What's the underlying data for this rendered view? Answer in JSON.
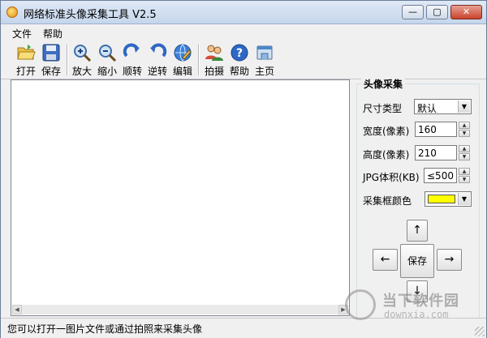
{
  "window": {
    "title": "网络标准头像采集工具 V2.5",
    "min_glyph": "—",
    "max_glyph": "▢",
    "close_glyph": "✕"
  },
  "menu": {
    "items": [
      {
        "label": "文件"
      },
      {
        "label": "帮助"
      }
    ]
  },
  "toolbar": {
    "items": [
      {
        "label": "打开",
        "icon": "open-folder-icon"
      },
      {
        "label": "保存",
        "icon": "save-disk-icon"
      },
      {
        "label": "放大",
        "icon": "zoom-in-icon"
      },
      {
        "label": "缩小",
        "icon": "zoom-out-icon"
      },
      {
        "label": "顺转",
        "icon": "rotate-cw-icon"
      },
      {
        "label": "逆转",
        "icon": "rotate-ccw-icon"
      },
      {
        "label": "编辑",
        "icon": "edit-icon"
      },
      {
        "label": "拍摄",
        "icon": "camera-people-icon"
      },
      {
        "label": "帮助",
        "icon": "help-icon"
      },
      {
        "label": "主页",
        "icon": "home-icon"
      }
    ]
  },
  "panel": {
    "title": "头像采集",
    "size_type_label": "尺寸类型",
    "size_type_value": "默认",
    "width_label": "宽度(像素)",
    "width_value": "160",
    "height_label": "高度(像素)",
    "height_value": "210",
    "jpg_label": "JPG体积(KB)",
    "jpg_value": "≤500",
    "frame_color_label": "采集框颜色",
    "frame_color": "#ffff00",
    "up_glyph": "↑",
    "down_glyph": "↓",
    "left_glyph": "←",
    "right_glyph": "→",
    "save_label": "保存"
  },
  "status": {
    "text": "您可以打开一图片文件或通过拍照来采集头像"
  },
  "watermark": {
    "cn": "当下软件园",
    "en": "downxia.com"
  }
}
